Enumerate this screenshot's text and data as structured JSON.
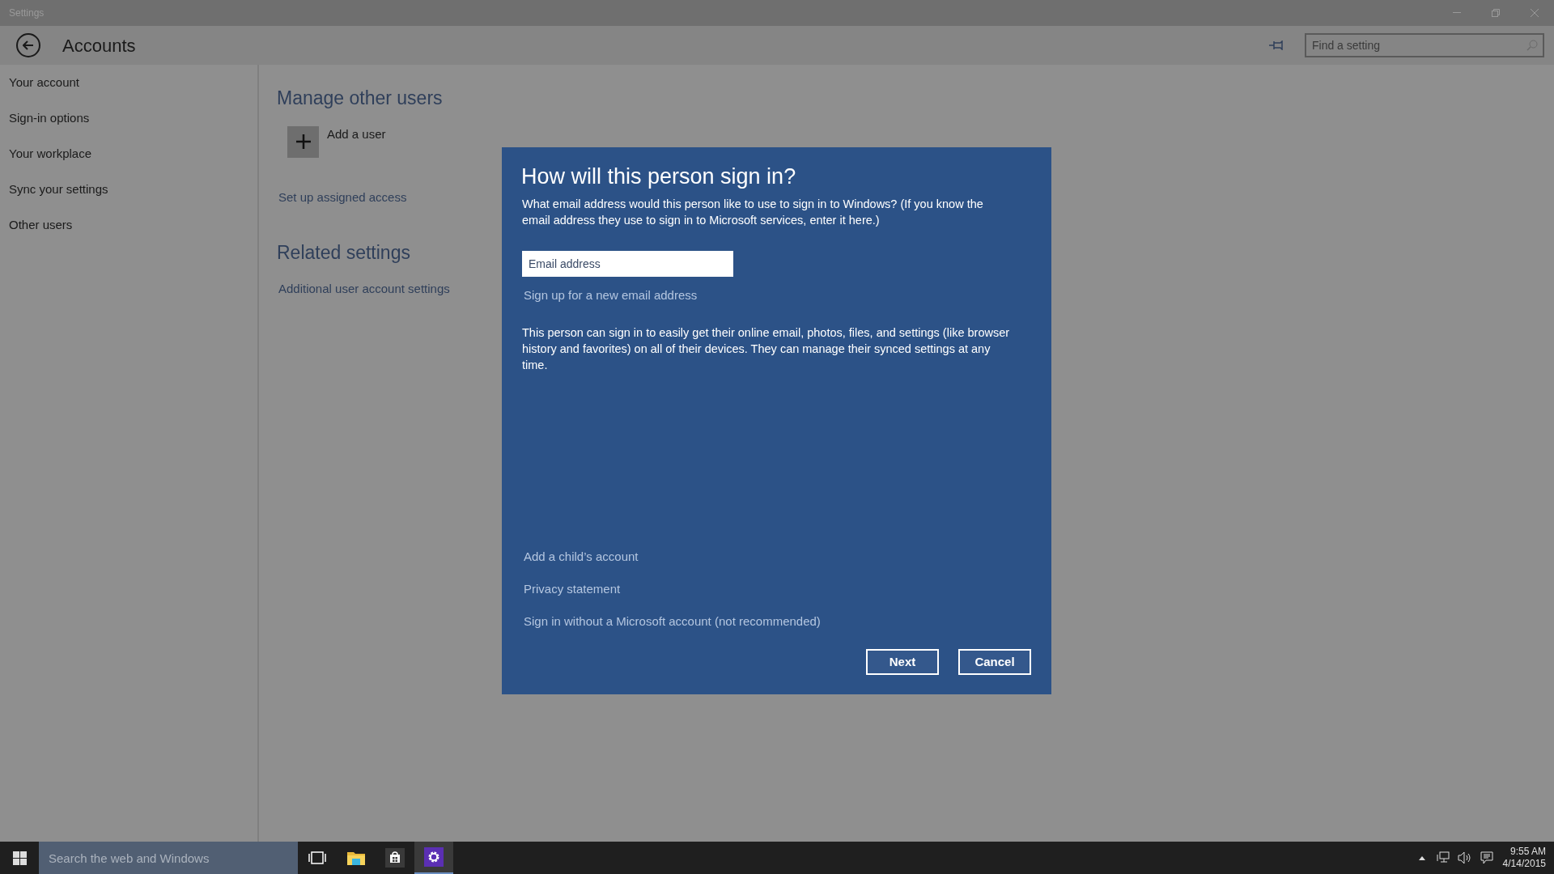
{
  "window": {
    "title": "Settings"
  },
  "header": {
    "title": "Accounts",
    "search": {
      "placeholder": "Find a setting"
    }
  },
  "sidebar": {
    "items": [
      {
        "label": "Your account"
      },
      {
        "label": "Sign-in options"
      },
      {
        "label": "Your workplace"
      },
      {
        "label": "Sync your settings"
      },
      {
        "label": "Other users"
      }
    ]
  },
  "main": {
    "heading": "Manage other users",
    "add_user": "Add a user",
    "assigned_access": "Set up assigned access",
    "related_heading": "Related settings",
    "related_link": "Additional user account settings"
  },
  "dialog": {
    "title": "How will this person sign in?",
    "intro": "What email address would this person like to use to sign in to Windows? (If you know the email address they use to sign in to Microsoft services, enter it here.)",
    "email": {
      "placeholder": "Email address"
    },
    "signup_link": "Sign up for a new email address",
    "description": "This person can sign in to easily get their online email, photos, files, and settings (like browser history and favorites) on all of their devices. They can manage their synced settings at any time.",
    "links": [
      "Add a child’s account",
      "Privacy statement",
      "Sign in without a Microsoft account (not recommended)"
    ],
    "buttons": [
      "Next",
      "Cancel"
    ]
  },
  "taskbar": {
    "search": {
      "placeholder": "Search the web and Windows"
    },
    "apps": [
      {
        "kind": "taskview",
        "selected": false
      },
      {
        "kind": "folder",
        "selected": false
      },
      {
        "kind": "store",
        "selected": false
      },
      {
        "kind": "settings",
        "selected": true
      }
    ],
    "clock": {
      "time": "9:55 AM",
      "date": "4/14/2015"
    }
  }
}
